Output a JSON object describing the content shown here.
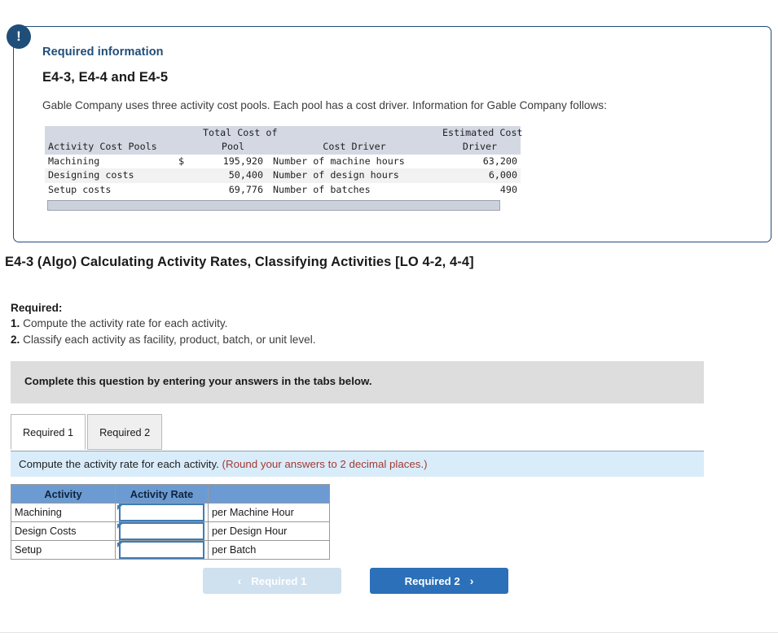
{
  "alert": {
    "icon": "exclamation-icon",
    "glyph": "!"
  },
  "card": {
    "required_information_label": "Required information",
    "problem_code": "E4-3, E4-4 and E4-5",
    "description": "Gable Company uses three activity cost pools. Each pool has a cost driver. Information for Gable Company follows:"
  },
  "info_table": {
    "headers": {
      "line1": {
        "col2": "Total Cost of",
        "col5": "Estimated Cost"
      },
      "line2": {
        "col1": "Activity Cost Pools",
        "col2": "Pool",
        "col4": "Cost Driver",
        "col5": "Driver"
      }
    },
    "rows": [
      {
        "pool": "Machining",
        "currency": "$",
        "amount": "195,920",
        "driver": "Number of machine hours",
        "estimated": "63,200"
      },
      {
        "pool": "Designing costs",
        "currency": "",
        "amount": "50,400",
        "driver": "Number of design hours",
        "estimated": "6,000"
      },
      {
        "pool": "Setup costs",
        "currency": "",
        "amount": "69,776",
        "driver": "Number of batches",
        "estimated": "490"
      }
    ]
  },
  "exercise": {
    "title": "E4-3 (Algo) Calculating Activity Rates, Classifying Activities [LO 4-2, 4-4]",
    "required_label": "Required:",
    "items": [
      {
        "num": "1.",
        "text": " Compute the activity rate for each activity."
      },
      {
        "num": "2.",
        "text": " Classify each activity as facility, product, batch, or unit level."
      }
    ]
  },
  "instruction_bar": {
    "text": "Complete this question by entering your answers in the tabs below."
  },
  "tabs": [
    {
      "label": "Required 1",
      "active": true
    },
    {
      "label": "Required 2",
      "active": false
    }
  ],
  "sub_instruction": {
    "text": "Compute the activity rate for each activity. ",
    "note": "(Round your answers to 2 decimal places.)"
  },
  "answer_table": {
    "headers": [
      "Activity",
      "Activity Rate",
      ""
    ],
    "rows": [
      {
        "activity": "Machining",
        "rate_value": "",
        "unit": "per Machine Hour"
      },
      {
        "activity": "Design Costs",
        "rate_value": "",
        "unit": "per Design Hour"
      },
      {
        "activity": "Setup",
        "rate_value": "",
        "unit": "per Batch"
      }
    ]
  },
  "nav": {
    "prev": {
      "label": "Required 1",
      "icon": "chevron-left-icon",
      "glyph": "‹",
      "disabled": true
    },
    "next": {
      "label": "Required 2",
      "icon": "chevron-right-icon",
      "glyph": "›",
      "disabled": false
    }
  },
  "colors": {
    "card_border": "#1f4e79",
    "accent_navy": "#1f4e79",
    "table_header_blue": "#6b9bd2",
    "info_banner_blue": "#d9ecfa",
    "note_red": "#a33a32",
    "primary_button": "#2b70b8",
    "disabled_button": "#cfe0ef",
    "grey_bar": "#dddddd"
  }
}
